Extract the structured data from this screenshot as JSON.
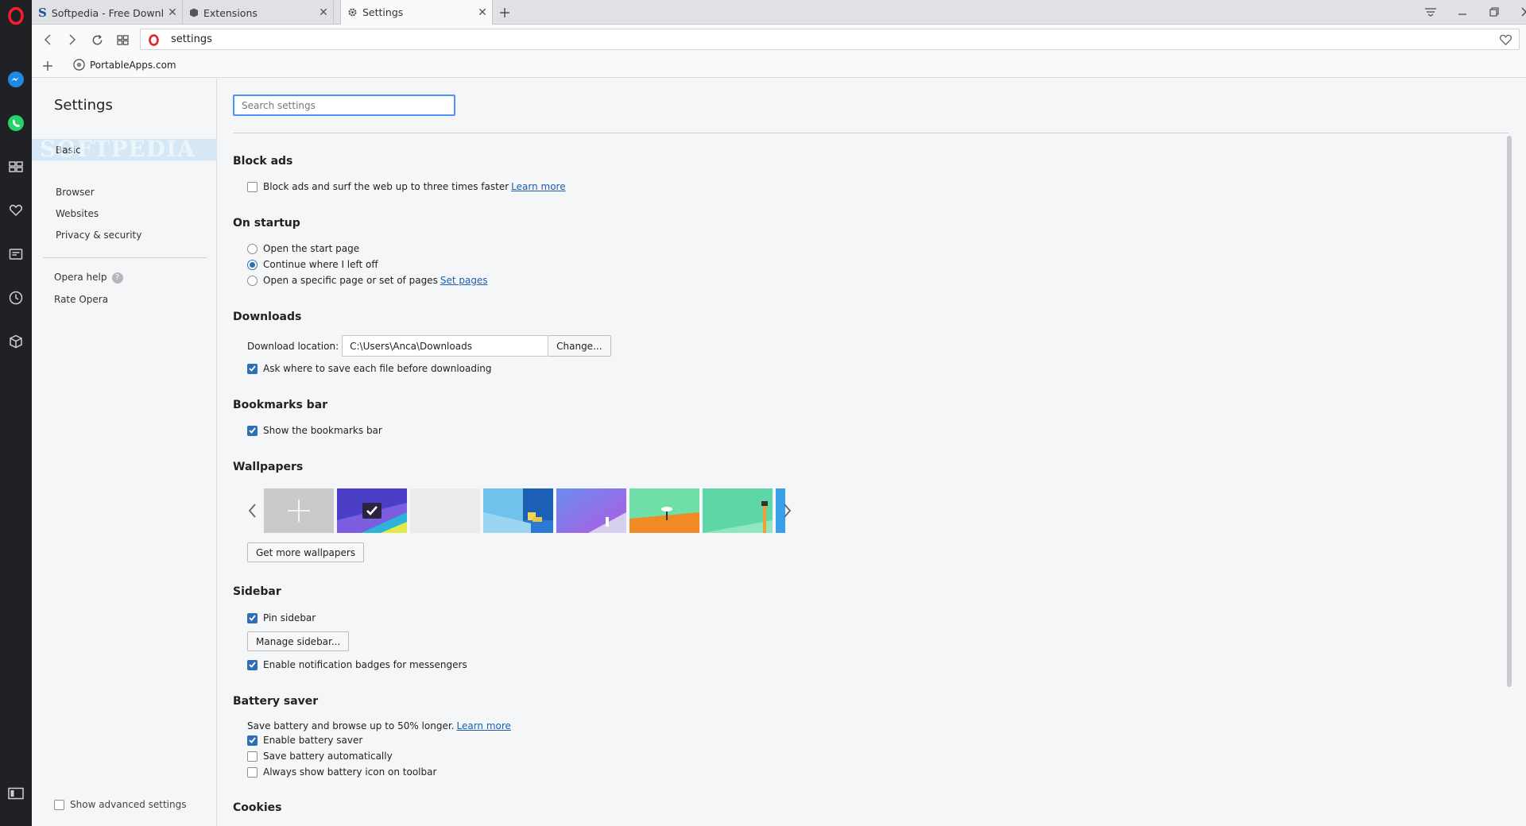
{
  "browser": {
    "tabs": [
      {
        "title": "Softpedia - Free Downloads",
        "icon": "softpedia-icon"
      },
      {
        "title": "Extensions",
        "icon": "extensions-cube-icon"
      },
      {
        "title": "Settings",
        "icon": "gear-icon",
        "active": true
      }
    ],
    "address": "settings",
    "bookmarks": [
      {
        "label": "PortableApps.com",
        "icon": "globe-icon"
      }
    ],
    "accent": "#2f6fb3"
  },
  "settings_nav": {
    "title": "Settings",
    "watermark": "SOFTPEDIA",
    "items": [
      {
        "label": "Basic",
        "active": true
      },
      {
        "label": "Browser"
      },
      {
        "label": "Websites"
      },
      {
        "label": "Privacy & security"
      }
    ],
    "help": "Opera help",
    "rate": "Rate Opera",
    "show_advanced": "Show advanced settings"
  },
  "main": {
    "search_placeholder": "Search settings",
    "block_ads": {
      "title": "Block ads",
      "option": "Block ads and surf the web up to three times faster",
      "link": "Learn more",
      "checked": false
    },
    "startup": {
      "title": "On startup",
      "options": [
        {
          "label": "Open the start page",
          "selected": false
        },
        {
          "label": "Continue where I left off",
          "selected": true
        },
        {
          "label": "Open a specific page or set of pages",
          "selected": false,
          "link": "Set pages"
        }
      ]
    },
    "downloads": {
      "title": "Downloads",
      "location_label": "Download location:",
      "location_value": "C:\\Users\\Anca\\Downloads",
      "change_button": "Change...",
      "ask_label": "Ask where to save each file before downloading",
      "ask_checked": true
    },
    "bookmarks_bar": {
      "title": "Bookmarks bar",
      "show_label": "Show the bookmarks bar",
      "checked": true
    },
    "wallpapers": {
      "title": "Wallpapers",
      "get_more_button": "Get more wallpapers"
    },
    "sidebar": {
      "title": "Sidebar",
      "pin_label": "Pin sidebar",
      "pin_checked": true,
      "manage_button": "Manage sidebar...",
      "badges_label": "Enable notification badges for messengers",
      "badges_checked": true
    },
    "battery": {
      "title": "Battery saver",
      "description": "Save battery and browse up to 50% longer.",
      "link": "Learn more",
      "options": [
        {
          "label": "Enable battery saver",
          "checked": true
        },
        {
          "label": "Save battery automatically",
          "checked": false
        },
        {
          "label": "Always show battery icon on toolbar",
          "checked": false
        }
      ]
    },
    "cookies": {
      "title": "Cookies"
    }
  }
}
